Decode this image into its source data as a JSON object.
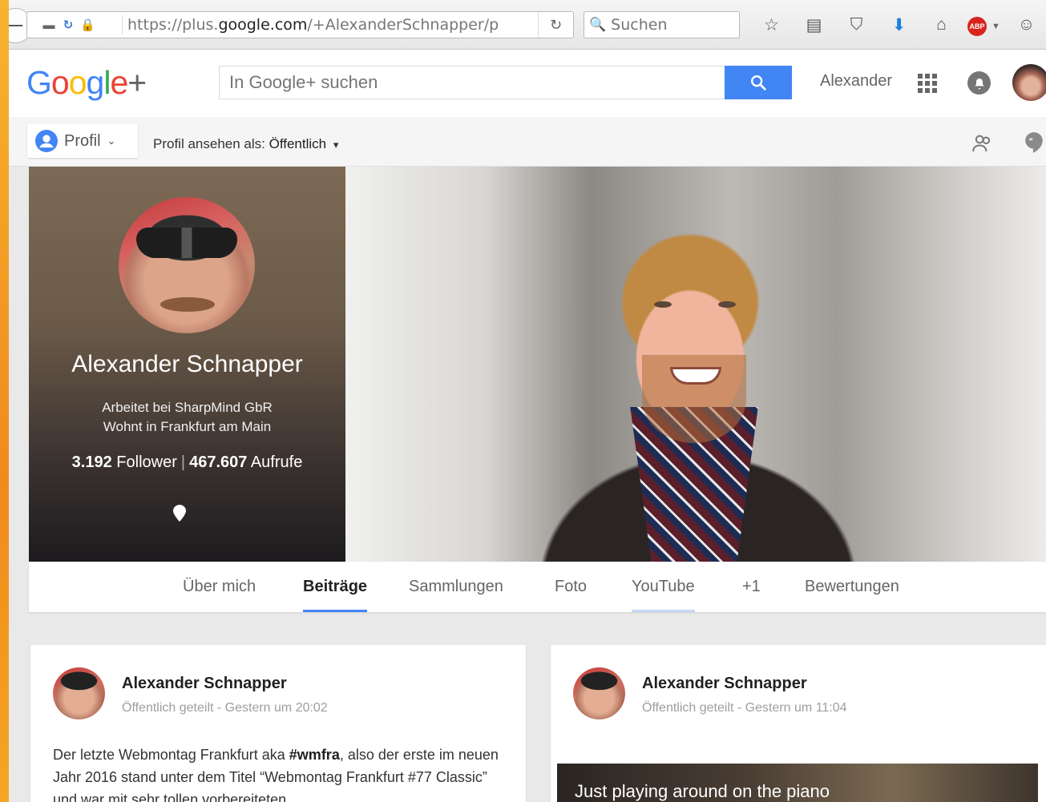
{
  "browser": {
    "url_prefix": "https://plus.",
    "url_domain": "google.com",
    "url_path": "/+AlexanderSchnapper/p",
    "search_placeholder": "Suchen",
    "abp_label": "ABP"
  },
  "header": {
    "logo": {
      "G": "G",
      "o1": "o",
      "o2": "o",
      "g": "g",
      "l": "l",
      "e": "e",
      "plus": "+"
    },
    "search_placeholder": "In Google+ suchen",
    "user_name": "Alexander"
  },
  "subbar": {
    "profile_label": "Profil",
    "view_as_label": "Profil ansehen als: ",
    "view_as_value": "Öffentlich"
  },
  "profile": {
    "name": "Alexander Schnapper",
    "work": "Arbeitet bei SharpMind GbR",
    "home": "Wohnt in Frankfurt am Main",
    "followers_count": "3.192",
    "followers_label": " Follower",
    "separator": "|",
    "views_count": "467.607",
    "views_label": " Aufrufe"
  },
  "tabs": [
    {
      "label": "Über mich"
    },
    {
      "label": "Beiträge"
    },
    {
      "label": "Sammlungen"
    },
    {
      "label": "Foto"
    },
    {
      "label": "YouTube"
    },
    {
      "label": "+1"
    },
    {
      "label": "Bewertungen"
    }
  ],
  "posts": [
    {
      "author": "Alexander Schnapper",
      "visibility": "Öffentlich geteilt",
      "dot": " - ",
      "time": "Gestern um 20:02",
      "text_1": "Der letzte Webmontag Frankfurt aka ",
      "hashtag": "#wmfra",
      "text_2": ", also der erste im neuen Jahr 2016 stand unter dem Titel “Webmontag Frankfurt #77 Classic” und war mit sehr tollen vorbereiteten"
    },
    {
      "author": "Alexander Schnapper",
      "visibility": "Öffentlich geteilt",
      "dot": " - ",
      "time": "Gestern um 11:04",
      "video_title": "Just playing around on the piano"
    }
  ]
}
